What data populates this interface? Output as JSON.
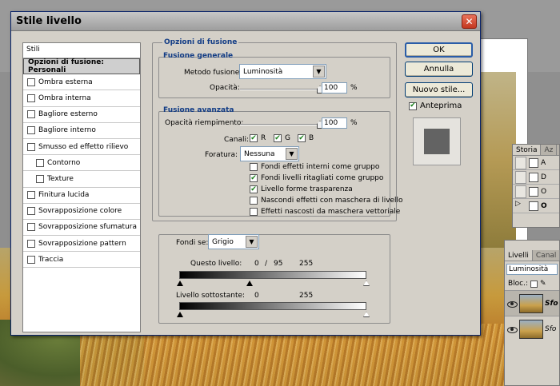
{
  "dialog": {
    "title": "Stile livello",
    "close_symbol": "✕"
  },
  "styles_list": {
    "header": "Stili",
    "selected": "Opzioni di fusione: Personali",
    "items": [
      {
        "label": "Ombra esterna",
        "indent": false,
        "checked": false
      },
      {
        "label": "Ombra interna",
        "indent": false,
        "checked": false
      },
      {
        "label": "Bagliore esterno",
        "indent": false,
        "checked": false
      },
      {
        "label": "Bagliore interno",
        "indent": false,
        "checked": false
      },
      {
        "label": "Smusso ed effetto rilievo",
        "indent": false,
        "checked": false
      },
      {
        "label": "Contorno",
        "indent": true,
        "checked": false
      },
      {
        "label": "Texture",
        "indent": true,
        "checked": false
      },
      {
        "label": "Finitura lucida",
        "indent": false,
        "checked": false
      },
      {
        "label": "Sovrapposizione colore",
        "indent": false,
        "checked": false
      },
      {
        "label": "Sovrapposizione sfumatura",
        "indent": false,
        "checked": false
      },
      {
        "label": "Sovrapposizione pattern",
        "indent": false,
        "checked": false
      },
      {
        "label": "Traccia",
        "indent": false,
        "checked": false
      }
    ]
  },
  "blending": {
    "title": "Opzioni di fusione",
    "general": {
      "title": "Fusione generale",
      "mode_label": "Metodo fusione:",
      "mode_value": "Luminosità",
      "opacity_label": "Opacità:",
      "opacity_value": "100",
      "opacity_unit": "%",
      "opacity_level": 1.0
    },
    "advanced": {
      "title": "Fusione avanzata",
      "fill_label": "Opacità riempimento:",
      "fill_value": "100",
      "fill_unit": "%",
      "fill_level": 1.0,
      "channels_label": "Canali:",
      "channels": [
        {
          "label": "R",
          "checked": true
        },
        {
          "label": "G",
          "checked": true
        },
        {
          "label": "B",
          "checked": true
        }
      ],
      "knockout_label": "Foratura:",
      "knockout_value": "Nessuna",
      "options": [
        {
          "label": "Fondi effetti interni come gruppo",
          "checked": false
        },
        {
          "label": "Fondi livelli ritagliati come gruppo",
          "checked": true
        },
        {
          "label": "Livello forme trasparenza",
          "checked": true
        },
        {
          "label": "Nascondi effetti con maschera di livello",
          "checked": false
        },
        {
          "label": "Effetti nascosti da maschera vettoriale",
          "checked": false
        }
      ]
    },
    "blend_if": {
      "label": "Fondi se:",
      "value": "Grigio",
      "this_layer_label": "Questo livello:",
      "this_layer_low": "0",
      "this_layer_sep": "/",
      "this_layer_mid": "95",
      "this_layer_high": "255",
      "underlying_label": "Livello sottostante:",
      "underlying_low": "0",
      "underlying_high": "255"
    }
  },
  "buttons": {
    "ok": "OK",
    "cancel": "Annulla",
    "new_style": "Nuovo stile...",
    "preview_label": "Anteprima",
    "preview_checked": true
  },
  "history_panel": {
    "tabs": [
      "Storia",
      "Az"
    ],
    "rows": [
      "A",
      "D",
      "O",
      "O"
    ]
  },
  "layers_panel": {
    "tabs": [
      "Livelli",
      "Canal"
    ],
    "blend_mode": "Luminosità",
    "lock_label": "Bloc.:",
    "layers": [
      {
        "name": "Sfo",
        "selected": true
      },
      {
        "name": "Sfo",
        "selected": false
      }
    ]
  },
  "colors": {
    "section_title": "#123c85",
    "check_green": "#1a7f1a",
    "close_red": "#c3371f"
  }
}
